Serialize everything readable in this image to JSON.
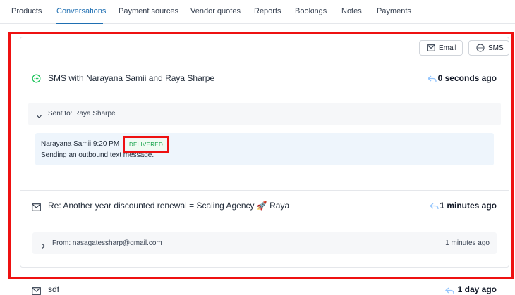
{
  "tabs": [
    {
      "label": "Products",
      "active": false
    },
    {
      "label": "Conversations",
      "active": true
    },
    {
      "label": "Payment sources",
      "active": false
    },
    {
      "label": "Vendor quotes",
      "active": false
    },
    {
      "label": "Reports",
      "active": false
    },
    {
      "label": "Bookings",
      "active": false
    },
    {
      "label": "Notes",
      "active": false
    },
    {
      "label": "Payments",
      "active": false
    }
  ],
  "actions": {
    "email_label": "Email",
    "sms_label": "SMS"
  },
  "threads": [
    {
      "icon": "sms-bubble-icon",
      "title": "SMS with Narayana Samii and Raya Sharpe",
      "time": "0 seconds ago",
      "sub": {
        "label": "Sent to: Raya Sharpe",
        "expanded": true
      },
      "message": {
        "sender_time": "Narayana Samii 9:20 PM",
        "status": "DELIVERED",
        "body": "Sending an outbound text message."
      }
    },
    {
      "icon": "mail-icon",
      "title": "Re: Another year discounted renewal = Scaling Agency 🚀 Raya",
      "time": "1 minutes ago",
      "sub": {
        "label": "From: nasagatessharp@gmail.com",
        "time": "1 minutes ago",
        "expanded": false
      }
    },
    {
      "icon": "mail-icon",
      "title": "sdf",
      "time": "1 day ago"
    }
  ],
  "colors": {
    "accent": "#1f6fb2",
    "highlight": "#ee1111",
    "delivered": "#16a34a"
  }
}
